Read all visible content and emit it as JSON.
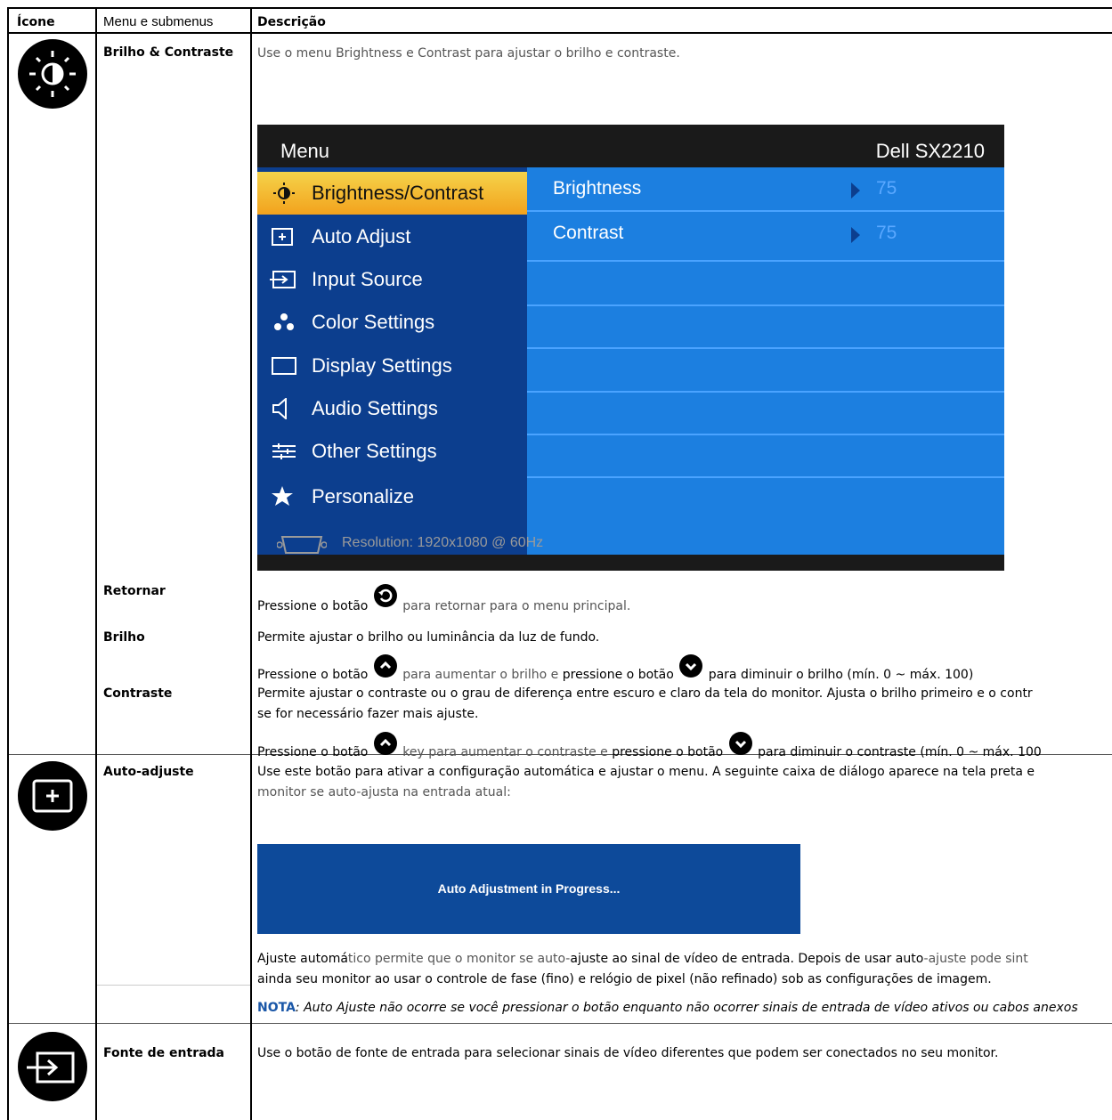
{
  "header": {
    "col_icon": "Ícone",
    "col_menu": "Menu e submenus",
    "col_desc": "Descrição"
  },
  "brightness": {
    "menu": "Brilho & Contraste",
    "desc": "Use o menu Brightness e Contrast para ajustar o brilho e contraste."
  },
  "osd": {
    "title_left": "Menu",
    "title_right": "Dell SX2210",
    "items": [
      "Brightness/Contrast",
      "Auto Adjust",
      "Input Source",
      "Color Settings",
      "Display Settings",
      "Audio Settings",
      "Other Settings",
      "Personalize"
    ],
    "rows": [
      {
        "label": "Brightness",
        "value": "75"
      },
      {
        "label": "Contrast",
        "value": "75"
      }
    ],
    "resolution": "Resolution: 1920x1080 @ 60Hz"
  },
  "retornar": {
    "menu": "Retornar",
    "pre": "Pressione o botão",
    "post": "para retornar para o menu principal."
  },
  "brilho": {
    "menu": "Brilho",
    "line1": "Permite ajustar o brilho ou luminância da luz de fundo.",
    "pre": "Pressione o botão",
    "mid": "para aumentar o brilho e",
    "mid2": "pressione o botão",
    "post": "para diminuir o brilho (mín. 0 ~ máx. 100)"
  },
  "contraste": {
    "menu": "Contraste",
    "line1": "Permite ajustar o contraste ou o grau de diferença entre escuro e claro da tela do monitor. Ajusta o brilho primeiro e o contr",
    "line2": "se for necessário fazer mais ajuste.",
    "pre": "Pressione o botão",
    "mid": "key para aumentar o contraste e",
    "mid2": "pressione o botão",
    "post": "para diminuir o contraste (mín. 0 ~ máx. 100"
  },
  "auto": {
    "menu": "Auto-adjuste",
    "line1": "Use este botão para ativar a configuração automática e ajustar o menu. A seguinte caixa de diálogo aparece na tela preta e",
    "line2": "monitor se auto-ajusta na entrada atual:",
    "dialog": "Auto Adjustment in Progress...",
    "p1a": "Ajuste automá",
    "p1b": "tico permite que o monitor se auto-",
    "p1c": "ajuste ao sinal de vídeo de entrada. Depois de usar auto",
    "p1d": "-ajuste pode sint",
    "p2": "ainda seu monitor ao usar o controle de fase (fino) e relógio de pixel (não refinado) sob as configurações de imagem.",
    "note_label": "NOTA",
    "note_text": ": Auto Ajuste não ocorre se você pressionar o botão enquanto não ocorrer sinais de entrada de vídeo ativos ou cabos anexos"
  },
  "input": {
    "menu": "Fonte de entrada",
    "desc": "Use o botão de fonte de entrada para selecionar sinais de vídeo diferentes que podem ser conectados no seu monitor."
  },
  "colors": {
    "note": "#1a57a8",
    "osd_left": "#0c3e8e",
    "osd_right": "#1c7fe0",
    "osd_sel": "#f3a21d"
  }
}
